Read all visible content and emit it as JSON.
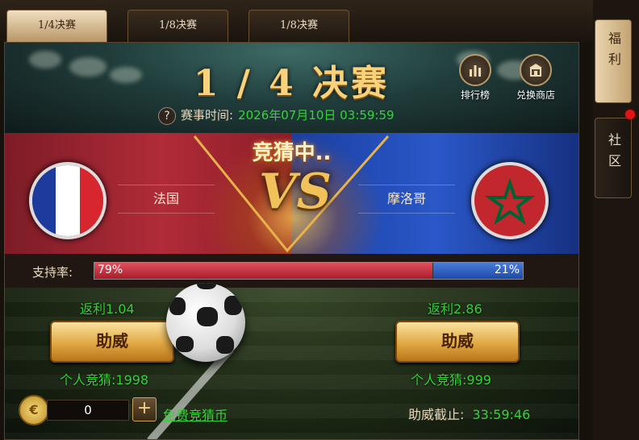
{
  "tabs": [
    "1/4决赛",
    "1/8决赛",
    "1/8决赛"
  ],
  "header": {
    "title": "1 / 4 决赛",
    "help_icon": "question-icon",
    "time_label": "赛事时间:",
    "time_value": "2026年07月10日 03:59:59",
    "ranking_label": "排行榜",
    "shop_label": "兑换商店"
  },
  "match": {
    "status": "竞猜中..",
    "vs": "VS",
    "left_team": {
      "name": "法国",
      "flag_colors": [
        "#1d3b9c",
        "#ffffff",
        "#d8262e"
      ]
    },
    "right_team": {
      "name": "摩洛哥",
      "flag_colors": [
        "#c1272d",
        "#006233"
      ]
    }
  },
  "support": {
    "label": "支持率:",
    "left_pct": "79%",
    "right_pct": "21%",
    "left_value": 79,
    "right_value": 21
  },
  "betting": {
    "left_return": "返利1.04",
    "right_return": "返利2.86",
    "cheer_label": "助威",
    "left_personal": "个人竞猜:1998",
    "right_personal": "个人竞猜:999"
  },
  "footer": {
    "coin_amount": "0",
    "plus_icon": "plus-icon",
    "free_coins_link": "免费竞猜币",
    "deadline_label": "助威截止:",
    "deadline_value": "33:59:46"
  },
  "side_tabs": [
    "福利",
    "社区"
  ],
  "colors": {
    "accent_green": "#35d237",
    "gold": "#f7d27a",
    "red": "#b12b38",
    "blue": "#2a58c8"
  }
}
